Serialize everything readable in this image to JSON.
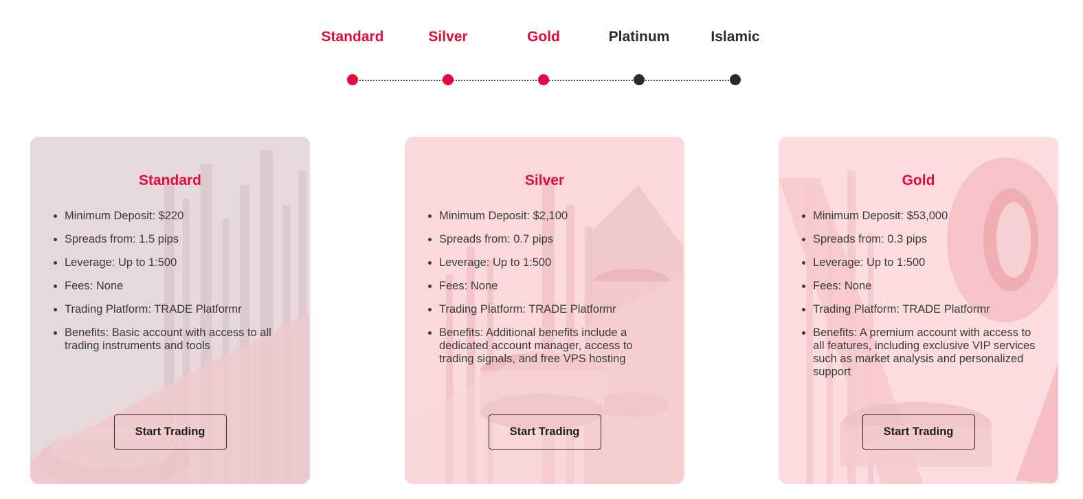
{
  "tiers": [
    "Standard",
    "Silver",
    "Gold",
    "Platinum",
    "Islamic"
  ],
  "tier_state": [
    true,
    true,
    true,
    false,
    false
  ],
  "colors": {
    "accent": "#e30b3c",
    "inactive": "#2b2b2b"
  },
  "cards": [
    {
      "title": "Standard",
      "features": [
        "Minimum Deposit: $220",
        "Spreads from: 1.5 pips",
        "Leverage: Up to 1:500",
        "Fees: None",
        "Trading Platform: TRADE Platformr",
        "Benefits: Basic account with access to all trading instruments and tools"
      ],
      "cta": "Start Trading"
    },
    {
      "title": "Silver",
      "features": [
        "Minimum Deposit: $2,100",
        "Spreads from: 0.7 pips",
        "Leverage: Up to 1:500",
        "Fees: None",
        "Trading Platform: TRADE Platformr",
        "Benefits: Additional benefits include a dedicated account manager, access to trading signals, and free VPS hosting"
      ],
      "cta": "Start Trading"
    },
    {
      "title": "Gold",
      "features": [
        "Minimum Deposit: $53,000",
        "Spreads from: 0.3 pips",
        "Leverage: Up to 1:500",
        "Fees: None",
        "Trading Platform: TRADE Platformr",
        "Benefits: A premium account with access to all features, including exclusive VIP services such as market analysis and personalized support"
      ],
      "cta": "Start Trading"
    }
  ]
}
